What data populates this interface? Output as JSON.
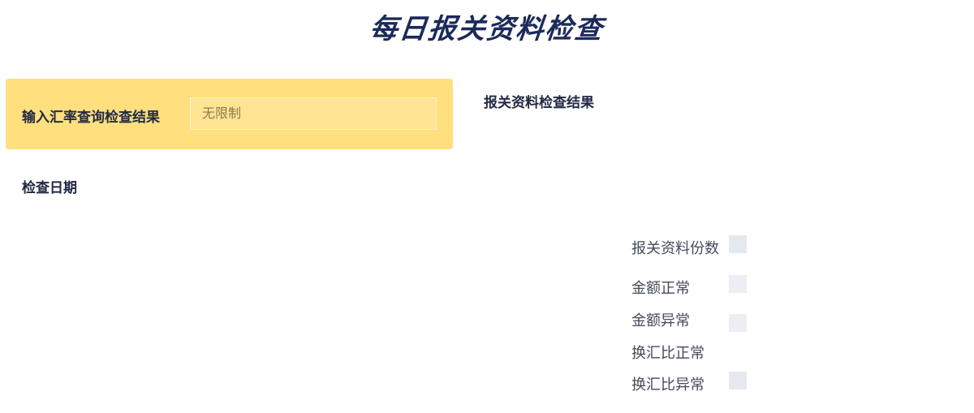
{
  "header": {
    "title": "每日报关资料检查"
  },
  "filter": {
    "label": "输入汇率查询检查结果",
    "input_value": "无限制"
  },
  "results": {
    "title": "报关资料检查结果"
  },
  "date_section": {
    "label": "检查日期"
  },
  "legend": {
    "items": [
      {
        "label": "报关资料份数",
        "color": "#e6e8ef"
      },
      {
        "label": "金额正常",
        "color": "#eceef4"
      },
      {
        "label": "金额异常",
        "color": "#eceef4"
      },
      {
        "label": "换汇比正常",
        "color": "#ffffff"
      },
      {
        "label": "换汇比异常",
        "color": "#e6e8ef"
      }
    ]
  },
  "colors": {
    "filter_panel_bg": "#ffdf7e",
    "title_color": "#1b2a5a"
  }
}
